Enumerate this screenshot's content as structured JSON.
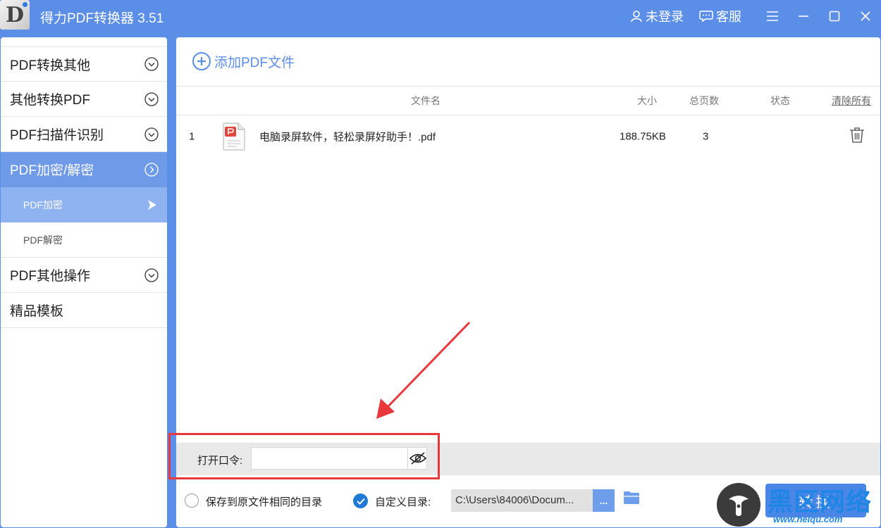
{
  "window": {
    "title": "得力PDF转换器 3.51",
    "logo_letter": "D",
    "login_label": "未登录",
    "service_label": "客服"
  },
  "sidebar": {
    "items": [
      {
        "label": "PDF转换其他"
      },
      {
        "label": "其他转换PDF"
      },
      {
        "label": "PDF扫描件识别"
      },
      {
        "label": "PDF加密/解密",
        "active": true
      },
      {
        "label": "PDF其他操作"
      },
      {
        "label": "精品模板"
      }
    ],
    "subitems": [
      {
        "label": "PDF加密",
        "active": true
      },
      {
        "label": "PDF解密"
      }
    ]
  },
  "main": {
    "add_label": "添加PDF文件",
    "columns": {
      "name": "文件名",
      "size": "大小",
      "pages": "总页数",
      "status": "状态",
      "clear": "清除所有"
    },
    "rows": [
      {
        "index": "1",
        "name": "电脑录屏软件，轻松录屏好助手！.pdf",
        "size": "188.75KB",
        "pages": "3",
        "status": ""
      }
    ],
    "password": {
      "label": "打开口令:",
      "value": ""
    },
    "output": {
      "same_dir_label": "保存到原文件相同的目录",
      "custom_dir_label": "自定义目录:",
      "path": "C:\\Users\\84006\\Docum...",
      "more_label": "...",
      "convert_label": "转换"
    }
  },
  "watermark": {
    "text": "黑区网络",
    "url": "www.heiqu.com"
  },
  "colors": {
    "accent": "#5b8ee6",
    "active_nav": "#6f9ae8",
    "active_sub": "#8fb2f0",
    "annotation": "#e8383d"
  }
}
